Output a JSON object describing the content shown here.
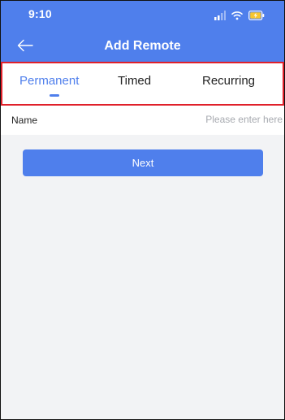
{
  "status_bar": {
    "time": "9:10",
    "icons": [
      "signal-icon",
      "wifi-icon",
      "battery-charging-icon"
    ]
  },
  "header": {
    "title": "Add Remote",
    "back_icon": "back-arrow-icon"
  },
  "tabs": [
    {
      "label": "Permanent",
      "active": true
    },
    {
      "label": "Timed",
      "active": false
    },
    {
      "label": "Recurring",
      "active": false
    }
  ],
  "form": {
    "name_label": "Name",
    "name_value": "",
    "name_placeholder": "Please enter here"
  },
  "actions": {
    "next_label": "Next"
  },
  "colors": {
    "primary": "#4f7fec",
    "highlight_border": "#e0202a",
    "background": "#f2f3f5",
    "placeholder": "#a7aab0",
    "battery": "#f7c62f"
  }
}
